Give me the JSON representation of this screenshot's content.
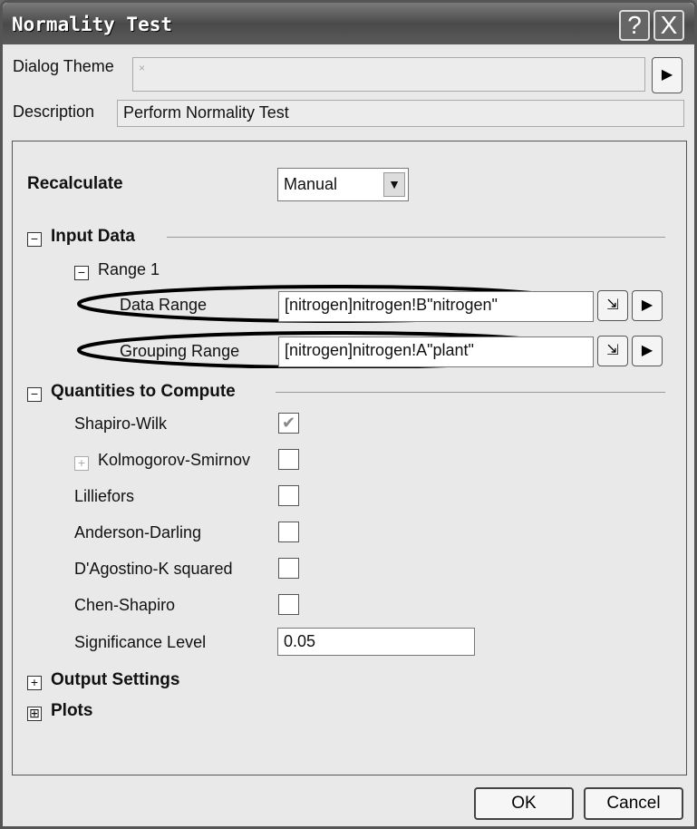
{
  "window": {
    "title": "Normality Test",
    "help": "?",
    "close": "X"
  },
  "dialog_theme": {
    "label": "Dialog Theme",
    "value": "×"
  },
  "description": {
    "label": "Description",
    "value": "Perform Normality Test"
  },
  "recalculate": {
    "label": "Recalculate",
    "value": "Manual"
  },
  "input_data": {
    "label": "Input Data",
    "range_label": "Range 1",
    "data_range": {
      "label": "Data Range",
      "value": "[nitrogen]nitrogen!B\"nitrogen\""
    },
    "grouping_range": {
      "label": "Grouping Range",
      "value": "[nitrogen]nitrogen!A\"plant\""
    }
  },
  "quantities": {
    "label": "Quantities to Compute",
    "items": [
      {
        "label": "Shapiro-Wilk",
        "checked": true
      },
      {
        "label": "Kolmogorov-Smirnov",
        "checked": false
      },
      {
        "label": "Lilliefors",
        "checked": false
      },
      {
        "label": "Anderson-Darling",
        "checked": false
      },
      {
        "label": "D'Agostino-K squared",
        "checked": false
      },
      {
        "label": "Chen-Shapiro",
        "checked": false
      }
    ],
    "significance": {
      "label": "Significance Level",
      "value": "0.05"
    }
  },
  "output_settings": {
    "label": "Output Settings"
  },
  "plots": {
    "label": "Plots"
  },
  "buttons": {
    "ok": "OK",
    "cancel": "Cancel"
  }
}
